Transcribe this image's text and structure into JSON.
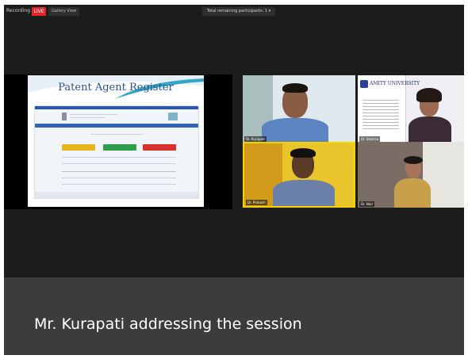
{
  "topbar": {
    "recording_label": "Recording",
    "live_badge": "LIVE",
    "view_mode": "Gallery View",
    "participants_label": "Total remaining participants: 1"
  },
  "shared_screen": {
    "slide_title": "Patent Agent Register"
  },
  "participants": [
    {
      "name": "Dr. Kurapati",
      "bg": "#dfe9ee"
    },
    {
      "name": "Dr. Sharma",
      "bg": "#efeff3"
    },
    {
      "name": "Dr. Prakash",
      "bg": "#e9c42a"
    },
    {
      "name": "Dr. Nair",
      "bg": "#7a6d66"
    }
  ],
  "amity_tile": {
    "university_name": "AMITY UNIVERSITY"
  },
  "caption": {
    "text": "Mr. Kurapati addressing the session"
  },
  "colors": {
    "live": "#e02828",
    "active_speaker_border": "#f2d400",
    "caption_bg": "#3c3c3c"
  },
  "icons": {
    "play_indicator": "triangle-icon"
  }
}
